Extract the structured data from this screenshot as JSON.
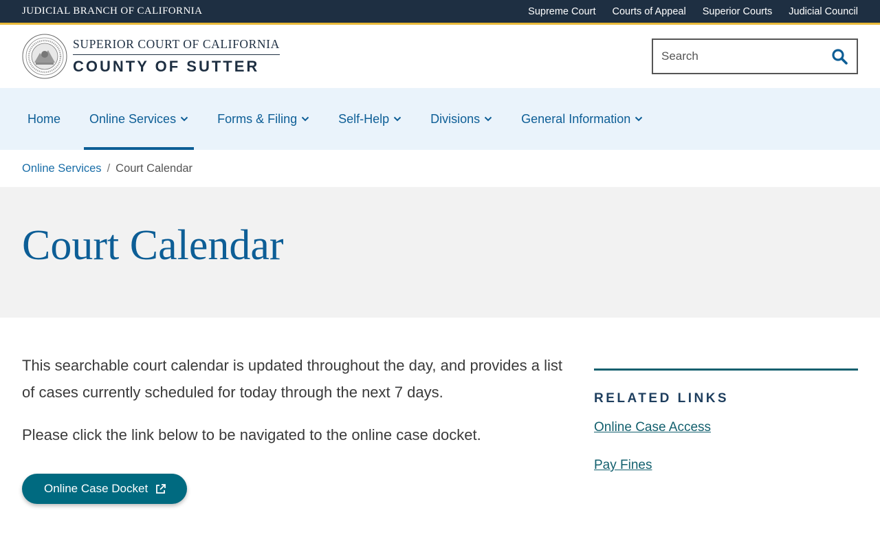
{
  "utility": {
    "branch": "JUDICIAL BRANCH OF CALIFORNIA",
    "links": [
      "Supreme Court",
      "Courts of Appeal",
      "Superior Courts",
      "Judicial Council"
    ]
  },
  "header": {
    "logo_top": "SUPERIOR COURT OF CALIFORNIA",
    "logo_bottom": "COUNTY OF SUTTER",
    "search_placeholder": "Search"
  },
  "nav": {
    "items": [
      {
        "label": "Home",
        "dropdown": false
      },
      {
        "label": "Online Services",
        "dropdown": true,
        "active": true
      },
      {
        "label": "Forms & Filing",
        "dropdown": true
      },
      {
        "label": "Self-Help",
        "dropdown": true
      },
      {
        "label": "Divisions",
        "dropdown": true
      },
      {
        "label": "General Information",
        "dropdown": true
      }
    ]
  },
  "breadcrumb": {
    "parent": "Online Services",
    "separator": "/",
    "current": "Court Calendar"
  },
  "page": {
    "title": "Court Calendar",
    "paragraph1": "This searchable court calendar is updated throughout the day, and provides a list of cases currently scheduled for today through the next 7  days.",
    "paragraph2": "Please click the link below to be navigated to the online case docket.",
    "button_label": "Online Case Docket"
  },
  "sidebar": {
    "title": "RELATED LINKS",
    "links": [
      "Online Case Access",
      "Pay Fines"
    ]
  },
  "colors": {
    "utility_bg": "#1e2f42",
    "accent_gold": "#e9b938",
    "nav_bg": "#eaf3fb",
    "link_blue": "#0d5e96",
    "teal": "#006a80"
  }
}
